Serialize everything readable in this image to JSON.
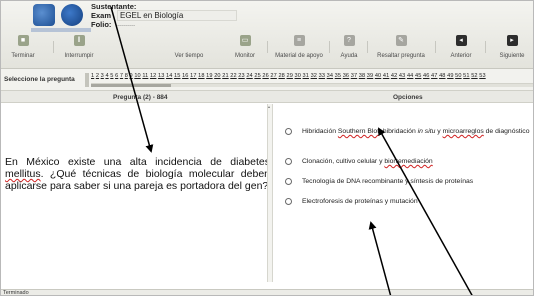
{
  "header": {
    "sustentante_label": "Sustentante:",
    "exam_label": "Exam",
    "exam_value": "EGEL en Biología",
    "folio_label": "Folio:",
    "folio_value": "---------"
  },
  "toolbar": {
    "terminar": "Terminar",
    "interrumpir": "Interrumpir",
    "ver_tiempo": "Ver tiempo",
    "monitor": "Monitor",
    "material_apoyo": "Material de apoyo",
    "ayuda": "Ayuda",
    "resaltar": "Resaltar pregunta",
    "anterior": "Anterior",
    "siguiente": "Siguiente"
  },
  "navigation": {
    "select_label": "Seleccione la pregunta",
    "question_numbers": [
      "1",
      "2",
      "3",
      "4",
      "5",
      "6",
      "7",
      "8",
      "9",
      "10",
      "11",
      "12",
      "13",
      "14",
      "15",
      "16",
      "17",
      "18",
      "19",
      "20",
      "21",
      "22",
      "23",
      "24",
      "25",
      "26",
      "27",
      "28",
      "29",
      "30",
      "31",
      "32",
      "33",
      "34",
      "35",
      "36",
      "37",
      "38",
      "39",
      "40",
      "41",
      "42",
      "43",
      "44",
      "45",
      "46",
      "47",
      "48",
      "49",
      "50",
      "51",
      "52",
      "53"
    ]
  },
  "columns": {
    "question_header": "Pregunta (2) - 884",
    "options_header": "Opciones"
  },
  "question": {
    "text": "En México existe una alta incidencia de diabetes mellitus. ¿Qué técnicas de biología molecular deben aplicarse para saber si una pareja es portadora del gen?"
  },
  "options": [
    {
      "text_a": "Hibridación ",
      "text_b": "Southern Blot",
      "text_c": ", hibridación ",
      "text_d": "in situ",
      "text_e": " y ",
      "text_f": "microarreglos",
      "text_g": " de diagnóstico"
    },
    {
      "text_a": "Clonación, cultivo celular y ",
      "text_b": "biorremediación"
    },
    {
      "text_a": "Tecnología de DNA recombinante y síntesis de proteínas"
    },
    {
      "text_a": "Electroforesis de proteínas y mutación"
    }
  ],
  "status": {
    "text": "Terminado"
  },
  "colors": {
    "accent": "#9aa38a",
    "dark_button": "#2d2d2d",
    "arrow": "#000000"
  }
}
